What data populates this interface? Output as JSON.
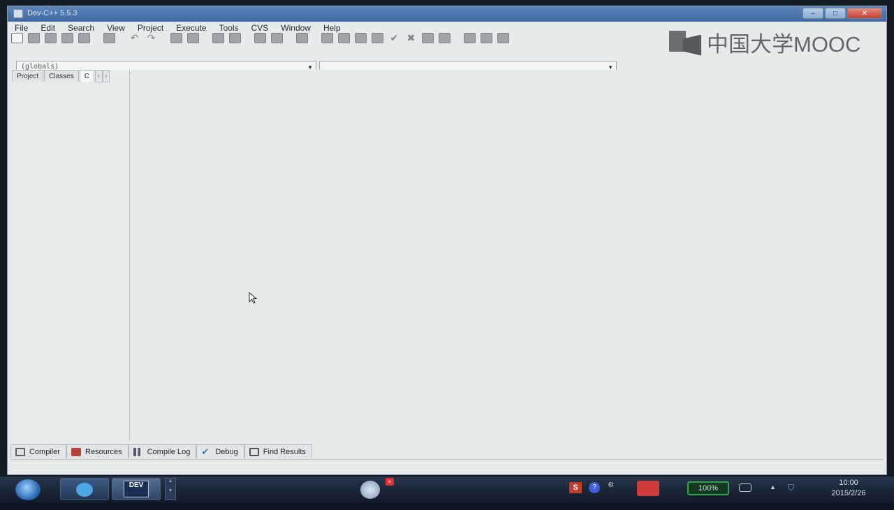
{
  "window": {
    "title": "Dev-C++ 5.5.3",
    "controls": {
      "minimize": "–",
      "maximize": "□",
      "close": "✕"
    }
  },
  "watermark": {
    "text": "中国大学MOOC"
  },
  "menu": [
    "File",
    "Edit",
    "Search",
    "View",
    "Project",
    "Execute",
    "Tools",
    "CVS",
    "Window",
    "Help"
  ],
  "toolbar": {
    "icons": [
      "new-file-icon",
      "open-icon",
      "save-icon",
      "save-all-icon",
      "close-icon",
      "print-icon",
      "undo-icon",
      "redo-icon",
      "find-icon",
      "replace-icon",
      "indent-icon",
      "unindent-icon",
      "goto-icon",
      "bookmark-icon",
      "compile-icon",
      "run-icon",
      "compile-run-icon",
      "rebuild-icon",
      "check-icon",
      "stop-icon",
      "chart-icon",
      "debug-icon",
      "class-icon",
      "project-new-icon",
      "project-add-icon"
    ]
  },
  "combos": {
    "scope": {
      "value": "(globals)"
    },
    "members": {
      "value": ""
    }
  },
  "left_panel": {
    "tabs": [
      "Project",
      "Classes",
      "C"
    ],
    "nav_prev": "‹",
    "nav_next": "›"
  },
  "bottom_tabs": [
    {
      "label": "Compiler",
      "icon": "compiler-icon"
    },
    {
      "label": "Resources",
      "icon": "resources-icon"
    },
    {
      "label": "Compile Log",
      "icon": "compile-log-icon"
    },
    {
      "label": "Debug",
      "icon": "debug-check-icon"
    },
    {
      "label": "Find Results",
      "icon": "find-results-icon"
    }
  ],
  "taskbar": {
    "dev_app_label": "DEV",
    "battery": "100%",
    "tray_s": "S",
    "tray_q": "?",
    "clock": {
      "time": "10:00",
      "date": "2015/2/26"
    }
  }
}
